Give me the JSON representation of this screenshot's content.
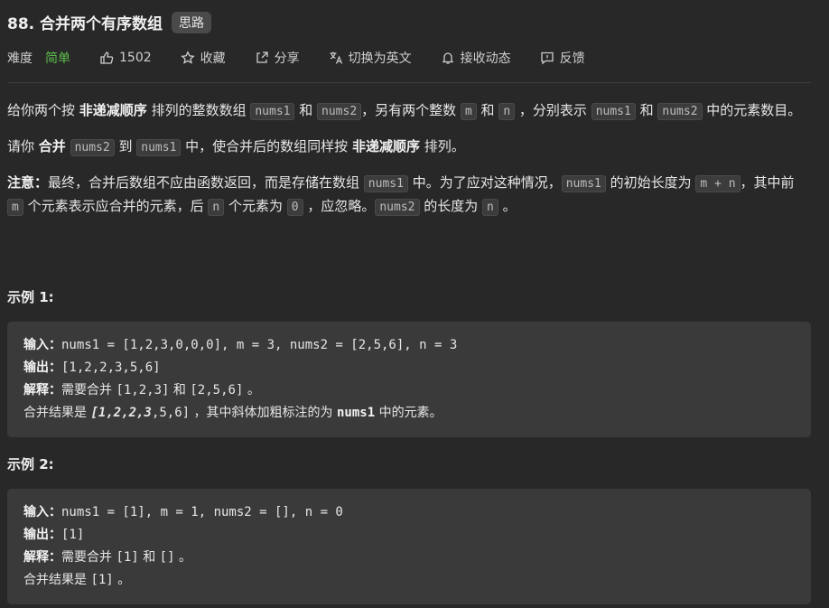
{
  "problem": {
    "title": "88. 合并两个有序数组",
    "tag": "思路"
  },
  "toolbar": {
    "difficulty_label": "难度",
    "difficulty_value": "简单",
    "likes": "1502",
    "collect": "收藏",
    "share": "分享",
    "switch_lang": "切换为英文",
    "subscribe": "接收动态",
    "feedback": "反馈"
  },
  "colors": {
    "background": "#282828",
    "easy_green": "#5cbd4b",
    "example_bg": "#3a3a3a"
  },
  "description": {
    "p1": {
      "t1": "给你两个按 ",
      "b1": "非递减顺序",
      "t2": " 排列的整数数组 ",
      "c1": "nums1",
      "t3": " 和 ",
      "c2": "nums2",
      "t4": "，另有两个整数 ",
      "c3": "m",
      "t5": " 和 ",
      "c4": "n",
      "t6": " ，分别表示 ",
      "c5": "nums1",
      "t7": " 和 ",
      "c6": "nums2",
      "t8": " 中的元素数目。"
    },
    "p2": {
      "t1": "请你 ",
      "b1": "合并",
      "t2": " ",
      "c1": "nums2",
      "t3": " 到 ",
      "c2": "nums1",
      "t4": " 中，使合并后的数组同样按 ",
      "b2": "非递减顺序",
      "t5": " 排列。"
    },
    "p3": {
      "b1": "注意：",
      "t1": "最终，合并后数组不应由函数返回，而是存储在数组 ",
      "c1": "nums1",
      "t2": " 中。为了应对这种情况，",
      "c2": "nums1",
      "t3": " 的初始长度为 ",
      "c3": "m + n",
      "t4": "，其中前 ",
      "c4": "m",
      "t5": " 个元素表示应合并的元素，后 ",
      "c5": "n",
      "t6": " 个元素为 ",
      "c6": "0",
      "t7": " ，应忽略。",
      "c7": "nums2",
      "t8": " 的长度为 ",
      "c8": "n",
      "t9": " 。"
    }
  },
  "example1": {
    "title": "示例 1:",
    "input_label": "输入：",
    "input": "nums1 = [1,2,3,0,0,0], m = 3, nums2 = [2,5,6], n = 3",
    "output_label": "输出：",
    "output": "[1,2,2,3,5,6]",
    "explain_label": "解释：",
    "explain_a": "需要合并 ",
    "explain_b": "[1,2,3]",
    "explain_c": " 和 ",
    "explain_d": "[2,5,6]",
    "explain_e": " 。",
    "result_a": "合并结果是 ",
    "result_open": "[",
    "result_b1": "1",
    "result_comma1": ",",
    "result_b2": "2",
    "result_mid": ",2,",
    "result_b3": "3",
    "result_tail": ",5,6]",
    "result_c": " ，其中斜体加粗标注的为 ",
    "result_d": "nums1",
    "result_e": " 中的元素。"
  },
  "example2": {
    "title": "示例 2:",
    "input_label": "输入：",
    "input": "nums1 = [1], m = 1, nums2 = [], n = 0",
    "output_label": "输出：",
    "output": "[1]",
    "explain_label": "解释：",
    "explain_a": "需要合并 ",
    "explain_b": "[1]",
    "explain_c": " 和 ",
    "explain_d": "[]",
    "explain_e": " 。",
    "result_a": "合并结果是 ",
    "result_b": "[1]",
    "result_e": " 。"
  }
}
